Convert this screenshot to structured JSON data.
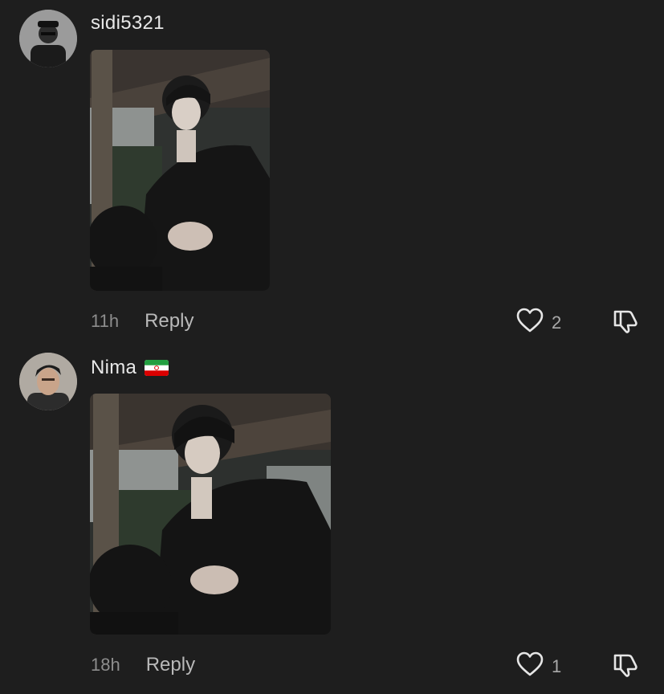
{
  "comments": [
    {
      "username": "sidi5321",
      "time": "11h",
      "reply_label": "Reply",
      "like_count": "2",
      "has_flag": false
    },
    {
      "username": "Nima",
      "flag": "iran-flag",
      "time": "18h",
      "reply_label": "Reply",
      "like_count": "1",
      "has_flag": true
    }
  ],
  "icons": {
    "like": "heart-outline-icon",
    "dislike": "thumbs-down-outline-icon"
  },
  "colors": {
    "background": "#1e1e1e",
    "username": "#e8e8e8",
    "timestamp": "#8d8d8d",
    "reply": "#b9b9b9"
  }
}
